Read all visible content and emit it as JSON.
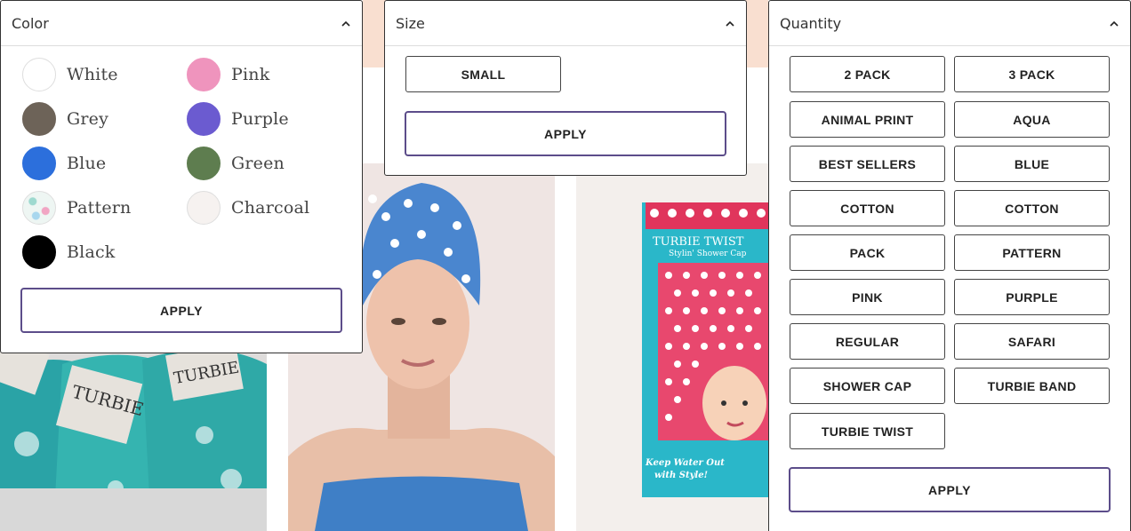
{
  "color_filter": {
    "title": "Color",
    "options": [
      {
        "label": "White",
        "swatch": "#ffffff"
      },
      {
        "label": "Pink",
        "swatch": "#ef94bd"
      },
      {
        "label": "Grey",
        "swatch": "#6d6358"
      },
      {
        "label": "Purple",
        "swatch": "#6b5bd0"
      },
      {
        "label": "Blue",
        "swatch": "#2c6fdc"
      },
      {
        "label": "Green",
        "swatch": "#5e7d4f"
      },
      {
        "label": "Pattern",
        "swatch": "pattern"
      },
      {
        "label": "Charcoal",
        "swatch": "#f6f2f0"
      },
      {
        "label": "Black",
        "swatch": "#000000"
      }
    ],
    "apply_label": "APPLY"
  },
  "size_filter": {
    "title": "Size",
    "options": [
      "SMALL"
    ],
    "apply_label": "APPLY"
  },
  "quantity_filter": {
    "title": "Quantity",
    "options": [
      "2 PACK",
      "3 PACK",
      "ANIMAL PRINT",
      "AQUA",
      "BEST SELLERS",
      "BLUE",
      "COTTON",
      "COTTON",
      "PACK",
      "PATTERN",
      "PINK",
      "PURPLE",
      "REGULAR",
      "SAFARI",
      "SHOWER CAP",
      "TURBIE BAND",
      "TURBIE TWIST"
    ],
    "apply_label": "APPLY"
  },
  "products": {
    "towel_tag_text": "TURBIE",
    "cap_box_brand": "TURBIE TWIST",
    "cap_box_subtitle": "Stylin' Shower Cap",
    "cap_box_tagline": "Keep Water Out with Style!"
  },
  "colors": {
    "accent_border": "#5c4d8a",
    "peach_band": "#f9dfd0",
    "panel_border": "#333333"
  }
}
